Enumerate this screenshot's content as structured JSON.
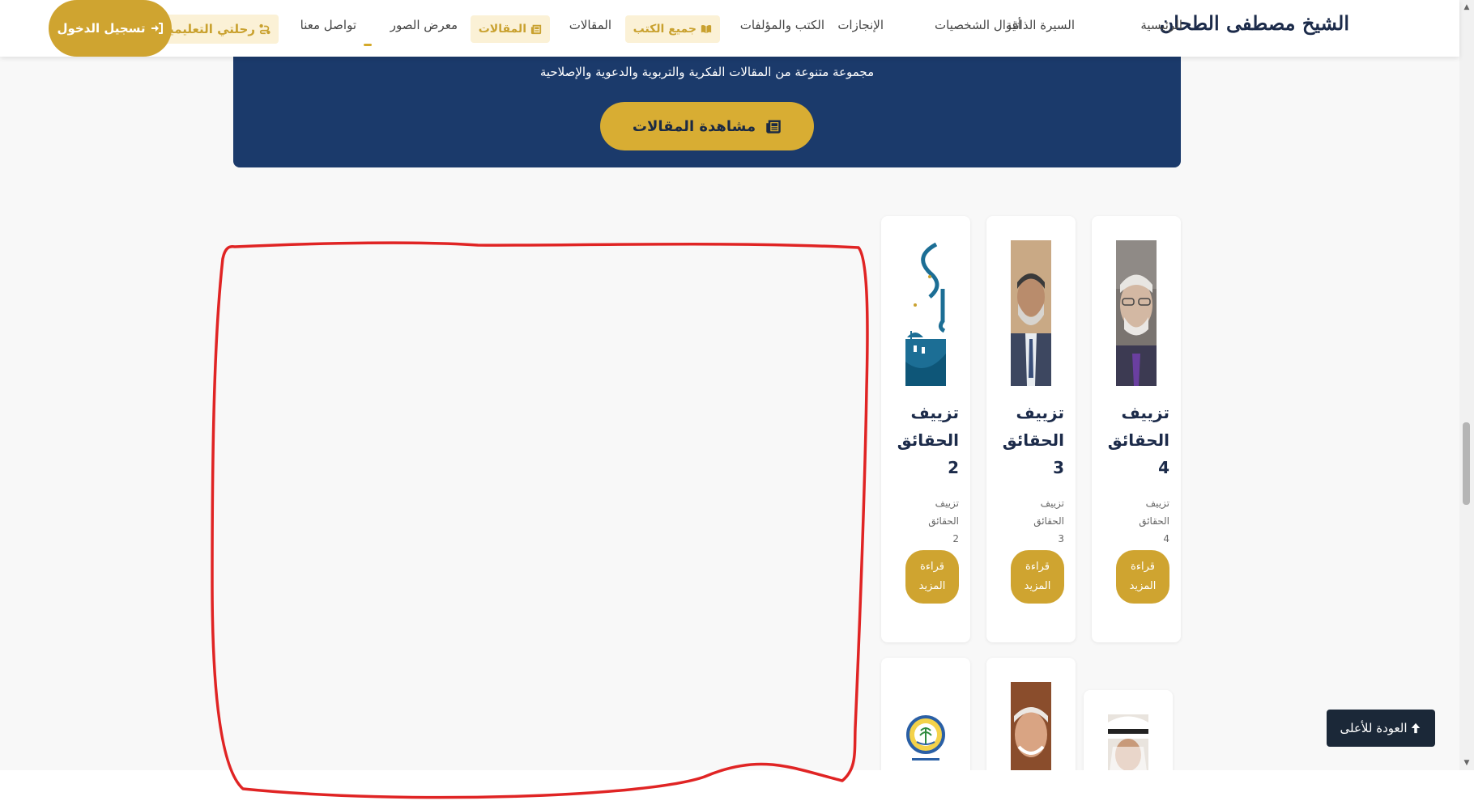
{
  "nav": {
    "brand": "الشيخ مصطفى الطحان",
    "items": [
      {
        "label": "الرئيسية"
      },
      {
        "label": "السيرة الذاتية"
      },
      {
        "label": "أقوال الشخصيات"
      },
      {
        "label": "الإنجازات"
      },
      {
        "label": "الكتب والمؤلفات"
      },
      {
        "label": "جميع الكتب"
      },
      {
        "label": "المقالات"
      },
      {
        "label": "المقالات"
      },
      {
        "label": "معرض الصور"
      },
      {
        "label": "تواصل معنا"
      },
      {
        "label": "رحلتي التعليمية"
      }
    ],
    "login": "تسجيل الدخول"
  },
  "hero": {
    "subtitle": "مجموعة متنوعة من المقالات الفكرية والتربوية والدعوية والإصلاحية",
    "button": "مشاهدة المقالات"
  },
  "cards": [
    {
      "title": "تزييف الحقائق 4",
      "excerpt": "تزييف الحقائق 4",
      "read_more": "قراءة المزيد",
      "image": "elderly-man-glasses-portrait"
    },
    {
      "title": "تزييف الحقائق 3",
      "excerpt": "تزييف الحقائق 3",
      "read_more": "قراءة المزيد",
      "image": "man-suit-grey-beard-portrait"
    },
    {
      "title": "تزييف الحقائق 2",
      "excerpt": "تزييف الحقائق 2",
      "read_more": "قراءة المزيد",
      "image": "blue-calligraphy-mosque-artwork"
    },
    {
      "image": "man-white-headwear-portrait"
    },
    {
      "image": "elderly-man-portrait"
    },
    {
      "image": "palm-tree-emblem-logo"
    }
  ],
  "back_to_top": "العودة للأعلى",
  "colors": {
    "navy": "#1b3a6b",
    "gold": "#cfa430",
    "gold_light": "#fbf1d6",
    "dark": "#1b2838",
    "annotation": "#e02424"
  }
}
